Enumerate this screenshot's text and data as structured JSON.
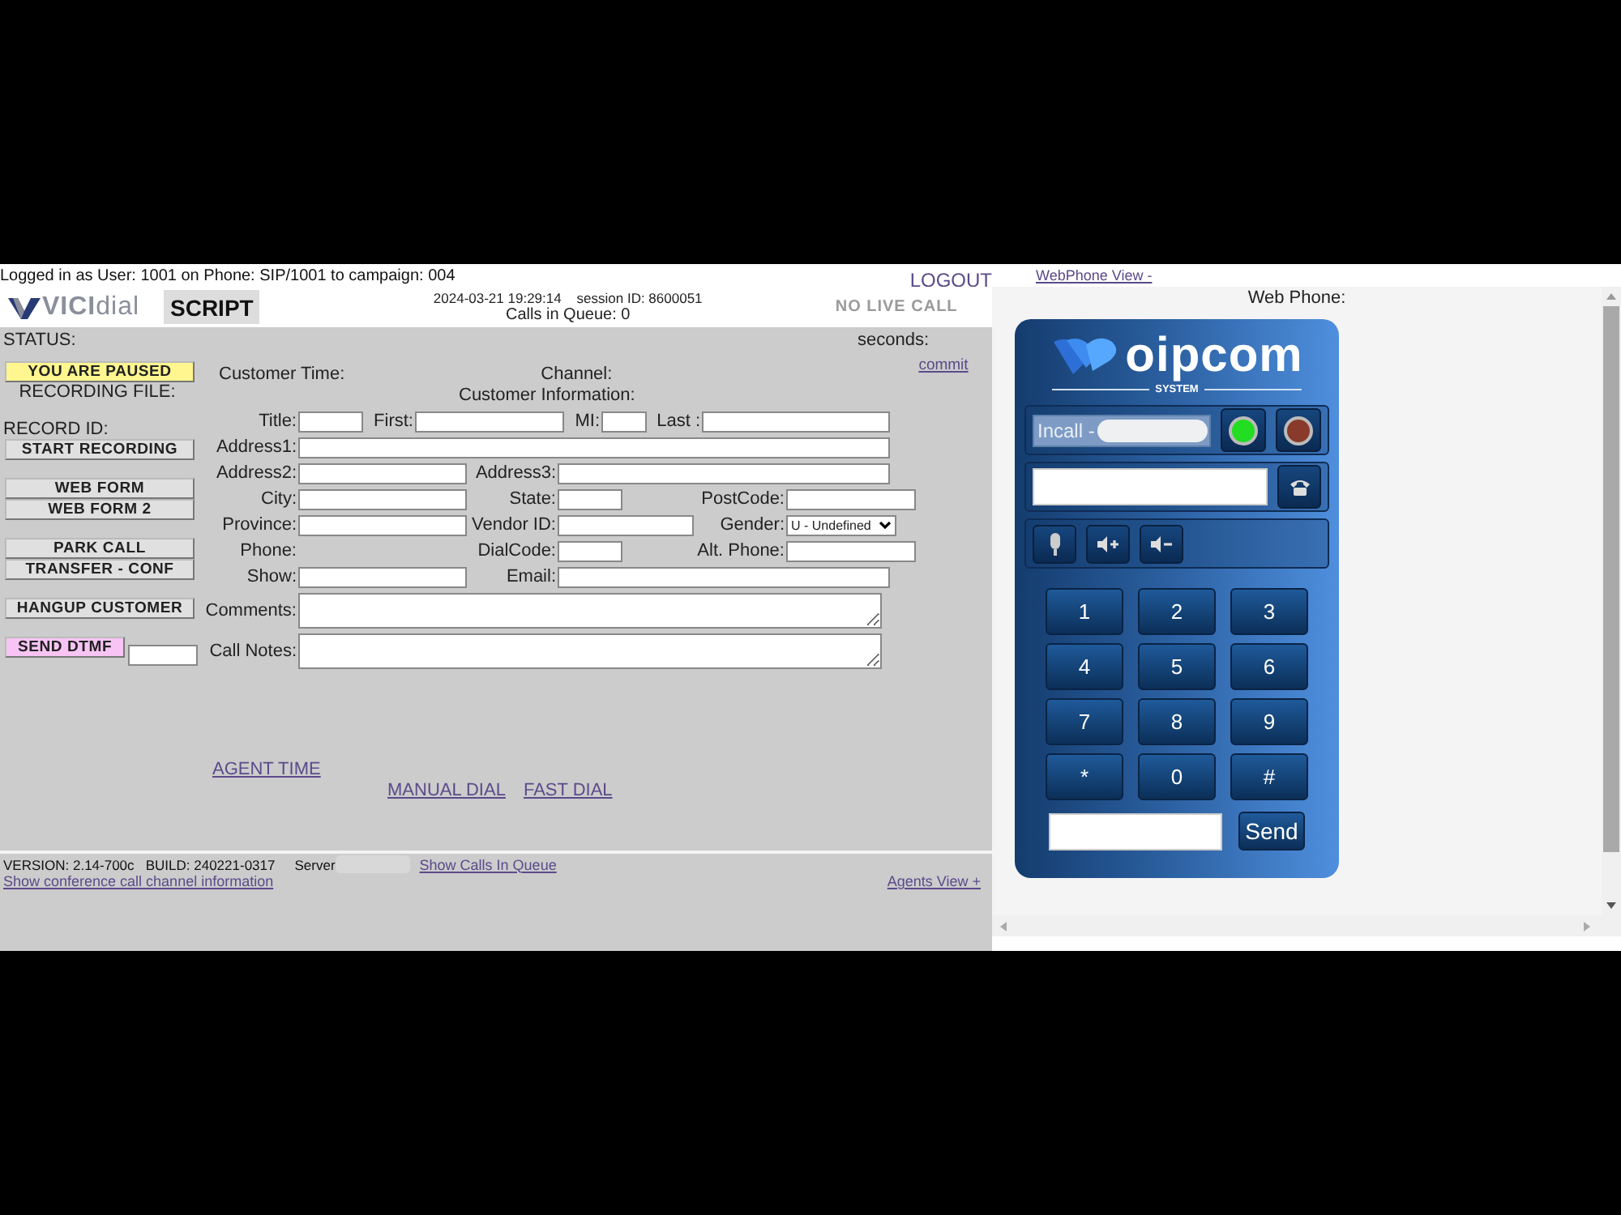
{
  "header": {
    "login_info": "Logged in as User: 1001 on Phone: SIP/1001  to campaign: 004",
    "logout": "LOGOUT",
    "logo": "**VICI**dial",
    "timestamp": "2024-03-21 19:29:14",
    "session": "session ID: 8600051",
    "calls_in_queue": "Calls in Queue: 0",
    "call_status": "NO LIVE CALL"
  },
  "tabs": [
    {
      "label": "SCRIPT",
      "selected": true
    }
  ],
  "status_label": "STATUS:",
  "seconds_label": "seconds:",
  "commit": "commit",
  "control_groups": [
    [
      {
        "kind": "button",
        "label": "YOU ARE PAUSED",
        "color": "#fff68f"
      },
      {
        "kind": "caption",
        "label": "RECORDING FILE:"
      }
    ],
    [
      {
        "kind": "heading",
        "label": "RECORD ID:"
      },
      {
        "kind": "button",
        "label": "START RECORDING",
        "color": "#e0e0e0"
      }
    ],
    [
      {
        "kind": "button",
        "label": "WEB FORM",
        "color": "#e0e0e0"
      },
      {
        "kind": "button",
        "label": "WEB FORM 2",
        "color": "#e0e0e0"
      }
    ],
    [
      {
        "kind": "button",
        "label": "PARK CALL",
        "color": "#e0e0e0"
      },
      {
        "kind": "button",
        "label": "TRANSFER - CONF",
        "color": "#e0e0e0"
      }
    ],
    [
      {
        "kind": "button",
        "label": "HANGUP CUSTOMER",
        "color": "#e0e0e0"
      }
    ],
    [
      {
        "kind": "dtmf",
        "label": "SEND DTMF",
        "color": "#f7c4f3"
      }
    ]
  ],
  "form": {
    "customer_time": "Customer Time:",
    "channel": "Channel:",
    "title": "Customer Information:",
    "rows": [
      [
        {
          "label": "Title:",
          "kind": "input"
        },
        {
          "label": "First:",
          "kind": "input"
        },
        {
          "label": "MI:",
          "kind": "input"
        },
        {
          "label": "Last :",
          "kind": "input"
        }
      ],
      [
        {
          "label": "Address1:",
          "kind": "input"
        }
      ],
      [
        {
          "label": "Address2:",
          "kind": "input"
        },
        {
          "label": "Address3:",
          "kind": "input"
        }
      ],
      [
        {
          "label": "City:",
          "kind": "input"
        },
        {
          "label": "State:",
          "kind": "input"
        },
        {
          "label": "PostCode:",
          "kind": "input"
        }
      ],
      [
        {
          "label": "Province:",
          "kind": "input"
        },
        {
          "label": "Vendor ID:",
          "kind": "input"
        },
        {
          "label": "Gender:",
          "kind": "select",
          "value": "U - Undefined"
        }
      ],
      [
        {
          "label": "Phone:",
          "kind": "none"
        },
        {
          "label": "DialCode:",
          "kind": "input"
        },
        {
          "label": "Alt. Phone:",
          "kind": "input"
        }
      ],
      [
        {
          "label": "Show:",
          "kind": "input"
        },
        {
          "label": "Email:",
          "kind": "input"
        }
      ],
      [
        {
          "label": "Comments:",
          "kind": "textarea"
        }
      ],
      [
        {
          "label": "Call Notes:",
          "kind": "textarea"
        }
      ]
    ]
  },
  "links": {
    "agent_time": "AGENT TIME",
    "manual_dial": "MANUAL DIAL",
    "fast_dial": "FAST DIAL"
  },
  "footer": {
    "version": "VERSION: 2.14-700c   BUILD: 240221-0317",
    "server_label": "Server",
    "show_calls": "Show Calls In Queue",
    "conf_info": "Show conference call channel information",
    "agents_view": "Agents View +"
  },
  "webphone": {
    "view_link": "WebPhone View -",
    "label": "Web Phone:",
    "brand": "oipcom",
    "tagline": "SYSTEM",
    "line_status": "Incall -",
    "keys": [
      "1",
      "2",
      "3",
      "4",
      "5",
      "6",
      "7",
      "8",
      "9",
      "*",
      "0",
      "#"
    ],
    "send": "Send"
  }
}
